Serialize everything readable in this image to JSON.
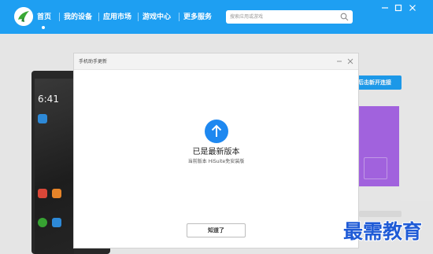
{
  "window": {
    "controls": [
      "minimize-icon",
      "restore-icon",
      "close-icon"
    ]
  },
  "nav": {
    "items": [
      {
        "label": "首页",
        "active": true
      },
      {
        "label": "我的设备"
      },
      {
        "label": "应用市场"
      },
      {
        "label": "游戏中心"
      },
      {
        "label": "更多服务"
      }
    ]
  },
  "search": {
    "placeholder": "搜索应用或游戏",
    "icon": "search-icon"
  },
  "background": {
    "phone_time": "6:41",
    "connect_button_label": "后击新开连接"
  },
  "dialog": {
    "title": "手机助手更新",
    "heading": "已是最新版本",
    "version_text": "当前版本 HiSuite免安装版",
    "ok_label": "知道了",
    "status_icon": "arrow-up-circle-icon"
  },
  "watermark": {
    "text": "最需教育"
  },
  "colors": {
    "brand_blue": "#1e9ff2",
    "dialog_bg": "#ffffff",
    "accent_purple": "#a867e6",
    "watermark_blue": "#1f5bd6"
  }
}
